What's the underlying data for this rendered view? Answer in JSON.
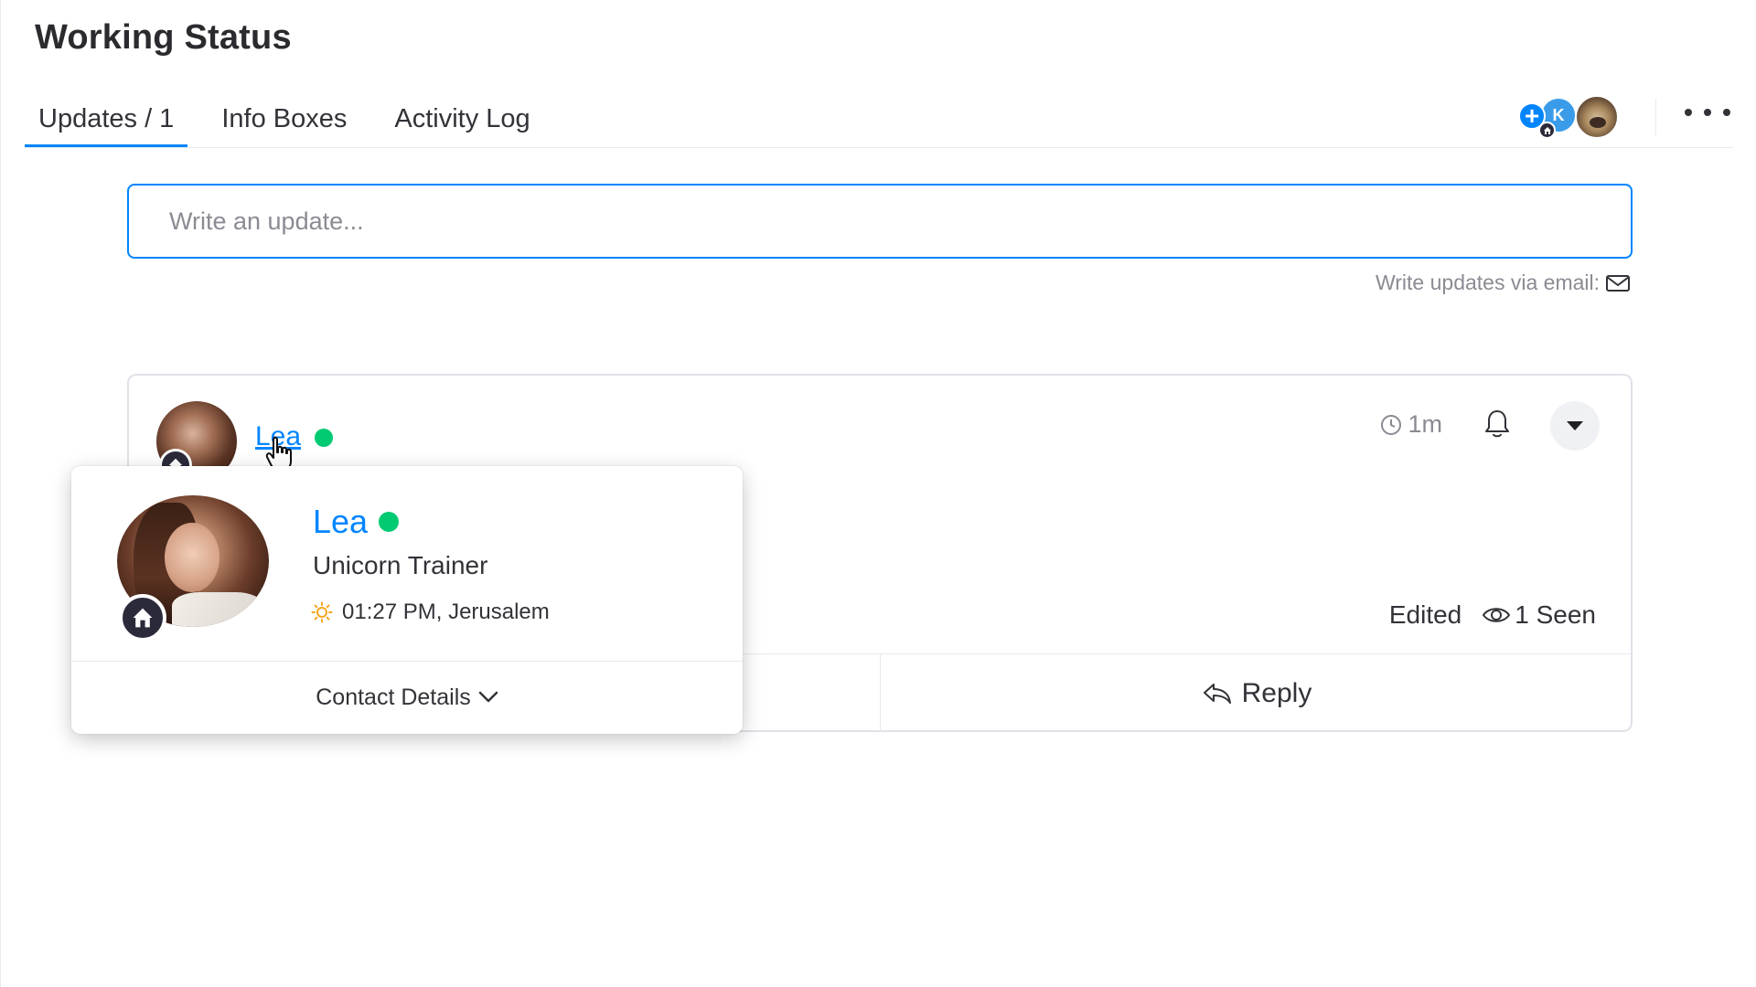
{
  "page": {
    "title": "Working Status"
  },
  "tabs": [
    {
      "label": "Updates / 1",
      "active": true
    },
    {
      "label": "Info Boxes",
      "active": false
    },
    {
      "label": "Activity Log",
      "active": false
    }
  ],
  "subscribers": {
    "plus_icon": "+",
    "initial": "K",
    "home_icon": "home-icon",
    "avatar": "dog-avatar"
  },
  "editor": {
    "placeholder": "Write an update...",
    "value": ""
  },
  "email_hint": {
    "label": "Write updates via email:",
    "icon": "mail-icon"
  },
  "post": {
    "author": "Lea",
    "online": true,
    "time": "1m",
    "edited_label": "Edited",
    "seen_label": "1 Seen",
    "reply_label": "Reply"
  },
  "profile_popup": {
    "name": "Lea",
    "online": true,
    "title": "Unicorn Trainer",
    "local_time": "01:27 PM, Jerusalem",
    "contact_label": "Contact Details"
  },
  "colors": {
    "accent": "#0085ff",
    "online": "#00ca72",
    "text": "#323338",
    "muted": "#8a8b93",
    "sun": "#f5a623"
  }
}
